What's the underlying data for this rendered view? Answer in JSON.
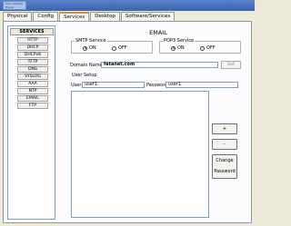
{
  "window": {
    "logo_text": [
      "Cisco Packet",
      "Tracer"
    ]
  },
  "tabs": [
    {
      "label": "Physical"
    },
    {
      "label": "Config"
    },
    {
      "label": "Services"
    },
    {
      "label": "Desktop"
    },
    {
      "label": "Software/Services"
    }
  ],
  "active_tab": "Services",
  "sidebar": {
    "header": "SERVICES",
    "items": [
      "HTTP",
      "DHCP",
      "DHCPv6",
      "TFTP",
      "DNS",
      "SYSLOG",
      "AAA",
      "NTP",
      "EMAIL",
      "FTP"
    ]
  },
  "email": {
    "title": "EMAIL",
    "smtp": {
      "legend": "SMTP Service",
      "on": "ON",
      "off": "OFF",
      "selected": "on"
    },
    "pop3": {
      "legend": "POP3 Service",
      "on": "ON",
      "off": "OFF",
      "selected": "on"
    },
    "domain_label": "Domain Name:",
    "domain_value": "fatanet.com",
    "set_button": "Set",
    "user_setup_label": "User Setup",
    "user_label": "User",
    "user_value": "user1",
    "password_label": "Password",
    "password_value": "user1",
    "add_button": "+",
    "remove_button": "-",
    "change_password_button": [
      "Change",
      "Password"
    ]
  },
  "colors": {
    "active_tab_accent": "#e68b2c",
    "radio_on": "#2a8a2a"
  }
}
